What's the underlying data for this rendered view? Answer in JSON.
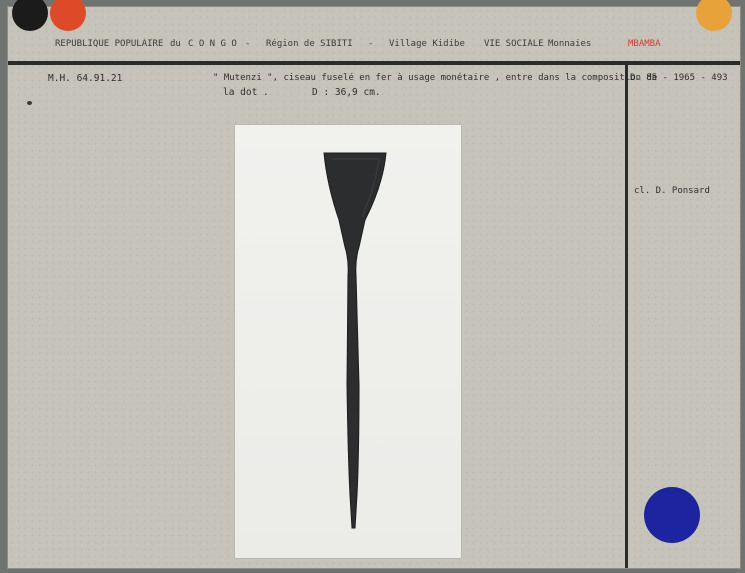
{
  "header": {
    "country": "REPUBLIQUE POPULAIRE",
    "du": "du",
    "congo": "C O N G O",
    "dash1": "-",
    "region": "Région de SIBITI",
    "dash2": "-",
    "village": "Village Kidibe",
    "category": "VIE SOCIALE",
    "subcategory": "Monnaies",
    "ethnic_group": "MBAMBA"
  },
  "record": {
    "inventory": "M.H. 64.91.21",
    "description_line1": "\" Mutenzi \", ciseau fuselé en fer à usage monétaire , entre dans la composition de",
    "description_line2": "la dot .",
    "dimension": "D : 36,9 cm.",
    "photo_ref": "D. 85 - 1965 - 493",
    "photographer": "cl. D. Ponsard"
  },
  "colors": {
    "card": "#c6c3ba",
    "rule": "#2a2c2b",
    "dot_black": "#1b1b1b",
    "dot_red": "#dc4a28",
    "dot_yellow": "#e8a23a",
    "dot_blue": "#1c24a0",
    "brand_red": "#d0413a"
  },
  "photo": {
    "subject_icon": "iron-chisel-currency-object"
  }
}
